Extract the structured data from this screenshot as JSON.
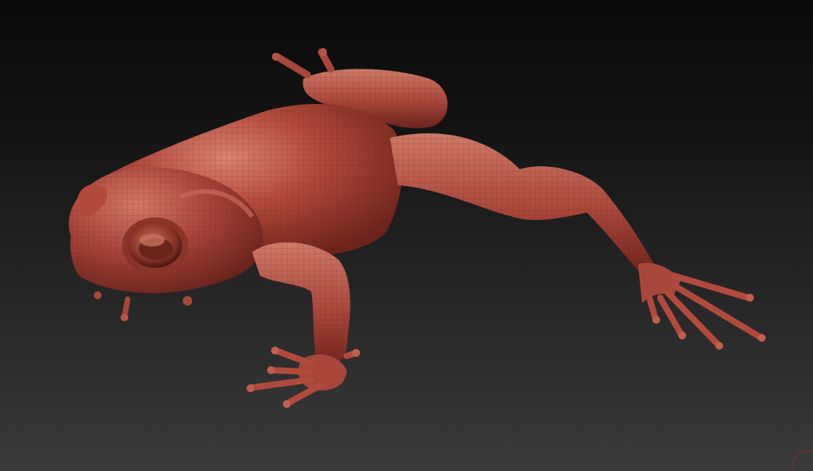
{
  "viewport": {
    "background_top": "#0a0a0a",
    "background_bottom": "#3a3a3a"
  },
  "model": {
    "kind": "frog-sculpt",
    "material_color": "#b24a3c",
    "shadow_color": "#6e231b",
    "highlight_color": "#d98473",
    "wireframe_visible": true
  },
  "gizmo": {
    "icon": "orientation-gizmo-icon",
    "color": "#8a2a2a"
  }
}
